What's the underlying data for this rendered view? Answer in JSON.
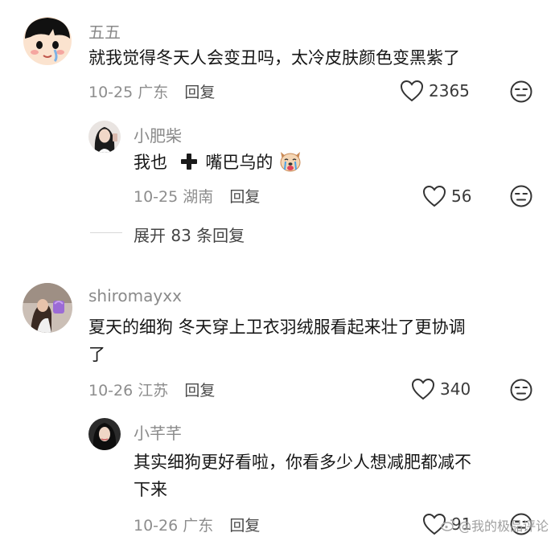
{
  "comments": [
    {
      "username": "五五",
      "text": "就我觉得冬天人会变丑吗，太冷皮肤颜色变黑紫了",
      "date": "10-25",
      "location": "广东",
      "reply_label": "回复",
      "likes": "2365",
      "replies": [
        {
          "username": "小肥柴",
          "text_before": "我也",
          "text_after": "嘴巴乌的",
          "date": "10-25",
          "location": "湖南",
          "reply_label": "回复",
          "likes": "56"
        }
      ],
      "expand_label": "展开 83 条回复"
    },
    {
      "username": "shiromayxx",
      "text_line1": "夏天的细狗 冬天穿上卫衣羽绒服看起来壮了更协调",
      "text_line2": "了",
      "date": "10-26",
      "location": "江苏",
      "reply_label": "回复",
      "likes": "340",
      "replies": [
        {
          "username": "小芊芊",
          "text_line1": "其实细狗更好看啦，你看多少人想减肥都减不",
          "text_line2": "下来",
          "date": "10-26",
          "location": "广东",
          "reply_label": "回复",
          "likes": "91"
        }
      ]
    }
  ],
  "watermark": "@我的极品评论",
  "icons": {
    "like": "heart-outline-icon",
    "dislike": "unamused-face-icon",
    "plus": "heavy-plus-icon",
    "emoji": "crying-dog-emoji-icon"
  }
}
